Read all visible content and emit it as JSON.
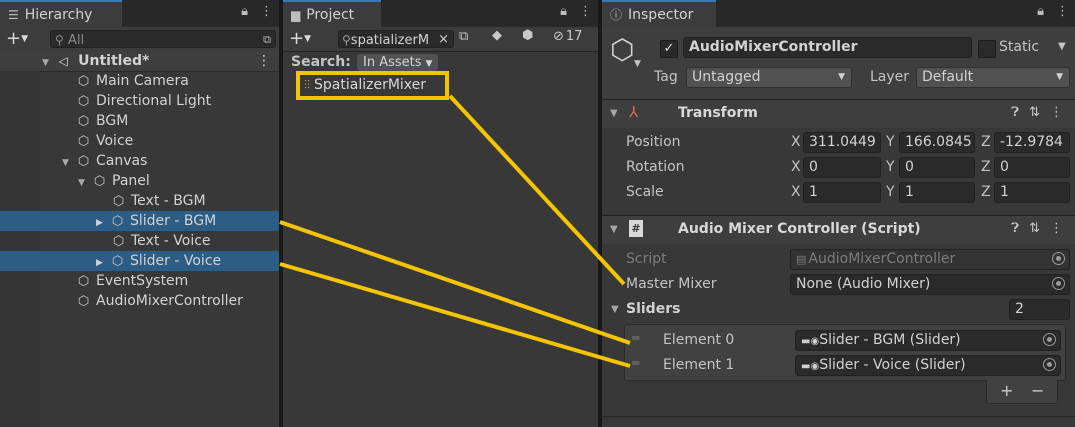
{
  "hierarchy": {
    "tab_label": "Hierarchy",
    "search_placeholder": "All",
    "scene_name": "Untitled*",
    "items": [
      {
        "label": "Main Camera"
      },
      {
        "label": "Directional Light"
      },
      {
        "label": "BGM"
      },
      {
        "label": "Voice"
      },
      {
        "label": "Canvas"
      },
      {
        "label": "Panel"
      },
      {
        "label": "Text - BGM"
      },
      {
        "label": "Slider - BGM"
      },
      {
        "label": "Text - Voice"
      },
      {
        "label": "Slider - Voice"
      },
      {
        "label": "EventSystem"
      },
      {
        "label": "AudioMixerController"
      }
    ]
  },
  "project": {
    "tab_label": "Project",
    "search_value": "spatializerM",
    "hidden_count": "17",
    "search_label": "Search:",
    "scope_label": "In Assets",
    "asset_label": "SpatializerMixer"
  },
  "inspector": {
    "tab_label": "Inspector",
    "object_name": "AudioMixerController",
    "static_label": "Static",
    "tag_label": "Tag",
    "tag_value": "Untagged",
    "layer_label": "Layer",
    "layer_value": "Default",
    "transform": {
      "title": "Transform",
      "position_label": "Position",
      "rotation_label": "Rotation",
      "scale_label": "Scale",
      "position": {
        "x": "311.0449",
        "y": "166.0845",
        "z": "-12.9784"
      },
      "rotation": {
        "x": "0",
        "y": "0",
        "z": "0"
      },
      "scale": {
        "x": "1",
        "y": "1",
        "z": "1"
      },
      "axis_x": "X",
      "axis_y": "Y",
      "axis_z": "Z"
    },
    "script_component": {
      "title": "Audio Mixer Controller (Script)",
      "script_label": "Script",
      "script_value": "AudioMixerController",
      "master_mixer_label": "Master Mixer",
      "master_mixer_value": "None (Audio Mixer)",
      "sliders_label": "Sliders",
      "sliders_count": "2",
      "elements": [
        {
          "label": "Element 0",
          "value": "Slider - BGM (Slider)"
        },
        {
          "label": "Element 1",
          "value": "Slider - Voice (Slider)"
        }
      ],
      "add_label": "+",
      "remove_label": "−"
    }
  },
  "colors": {
    "annotation": "#f5c400",
    "selection": "#2c5d87"
  }
}
